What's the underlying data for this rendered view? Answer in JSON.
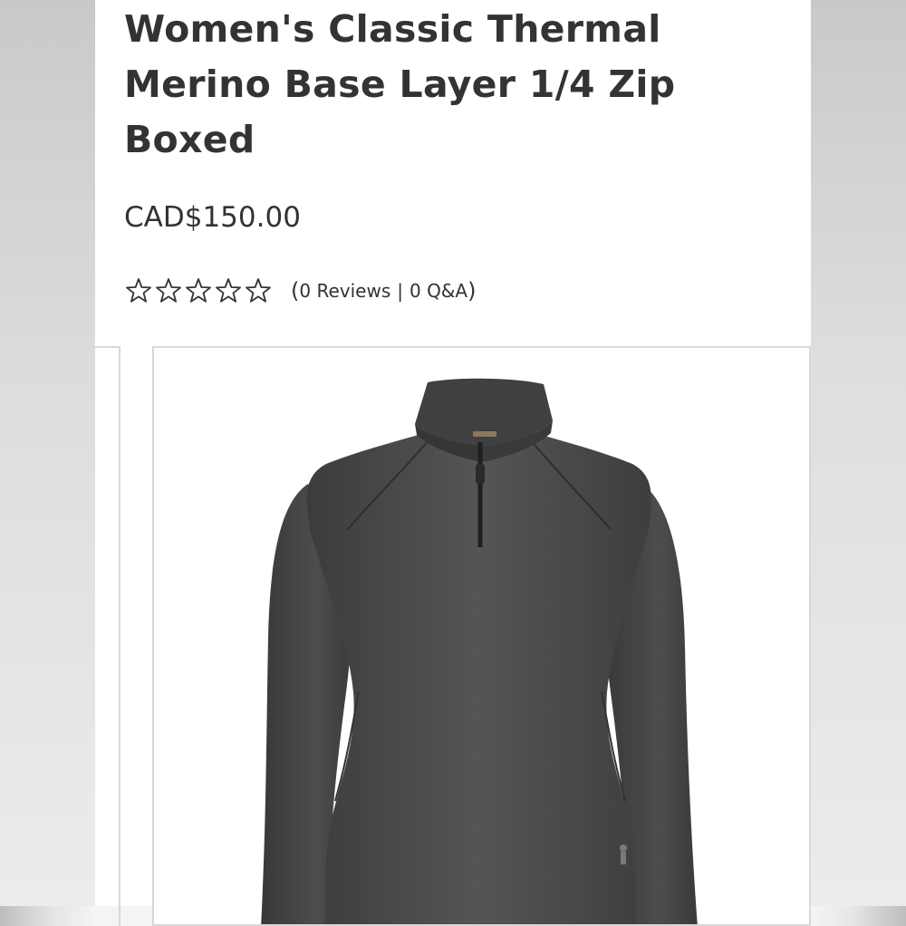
{
  "product": {
    "title": "Women's Classic Thermal Merino Base Layer 1/4 Zip Boxed",
    "price": "CAD$150.00",
    "rating": {
      "stars_filled": 0,
      "stars_total": 5,
      "open_paren": "(",
      "reviews_label": "0 Reviews",
      "separator": "|",
      "qa_label": "0 Q&A",
      "close_paren": ")"
    },
    "image": {
      "icon": "product-photo-quarter-zip-top",
      "garment_color": "#4a4a4a"
    }
  },
  "colors": {
    "text": "#333333",
    "border": "#d8d8d8",
    "page_bg": "#ffffff"
  }
}
